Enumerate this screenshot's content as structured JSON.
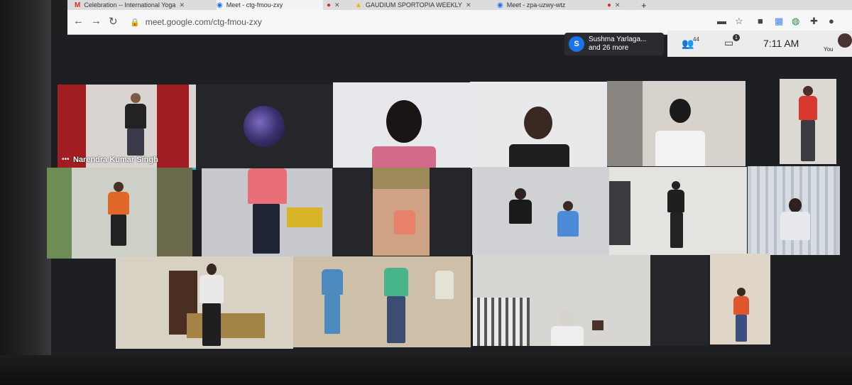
{
  "tabs": [
    {
      "title": "Celebration -- International Yoga",
      "icon": "gmail-icon"
    },
    {
      "title": "Meet - ctg-fmou-zxy",
      "icon": "meet-icon"
    },
    {
      "title": "GAUDIUM SPORTOPIA WEEKLY",
      "icon": "drive-icon"
    },
    {
      "title": "Meet - zpa-uzwy-wtz",
      "icon": "meet-icon"
    }
  ],
  "address_bar": {
    "url": "meet.google.com/ctg-fmou-zxy"
  },
  "meet": {
    "presenter_initial": "S",
    "people_line1": "Sushma Yarlaga...",
    "people_line2": "and 26 more",
    "participant_count": "44",
    "chat_badge": "1",
    "time": "7:11 AM",
    "you_label": "You"
  },
  "tiles": {
    "speaker_name": "Narendra Kumar Singh"
  },
  "colors": {
    "meet_background": "#1e1f22",
    "speaking_indicator": "#3fb6c8",
    "avatar_blue": "#1a73e8"
  }
}
